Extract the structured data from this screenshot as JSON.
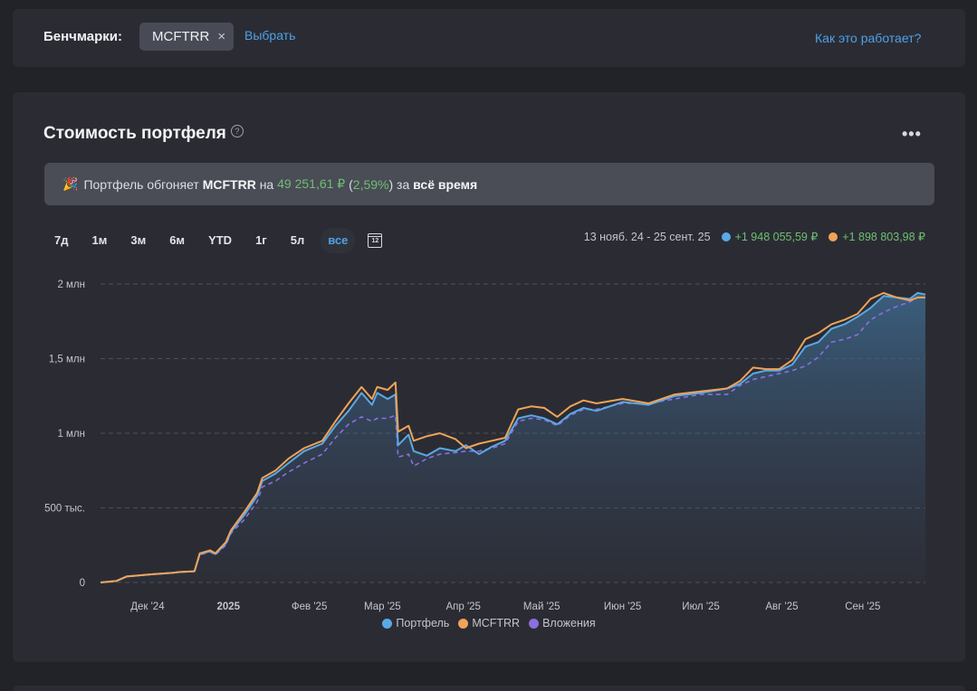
{
  "benchmarks": {
    "label": "Бенчмарки:",
    "chip": "MCFTRR",
    "chip_remove": "×",
    "choose_link": "Выбрать",
    "help_link": "Как это работает?"
  },
  "portfolio": {
    "title": "Стоимость портфеля",
    "help_icon": "?",
    "menu_icon": "•••",
    "banner": {
      "prefix": "Портфель обгоняет",
      "benchmark": "MCFTRR",
      "on": "на",
      "amount": "49 251,61 ₽",
      "paren_open": "(",
      "percent": "2,59%",
      "paren_close": ")",
      "for": "за",
      "period": "всё время"
    },
    "periods": [
      "7д",
      "1м",
      "3м",
      "6м",
      "YTD",
      "1г",
      "5л",
      "все"
    ],
    "active_period": "все",
    "calendar_day": "12",
    "summary": {
      "range": "13 нояб. 24 - 25 сент. 25",
      "portfolio_gain": "+1 948 055,59 ₽",
      "benchmark_gain": "+1 898 803,98 ₽"
    }
  },
  "colors": {
    "portfolio": "#5aa9e6",
    "benchmark": "#f0a35a",
    "investments": "#8b6fe0",
    "positive": "#6fbf73",
    "accent": "#4ea1e8"
  },
  "chart_data": {
    "type": "line",
    "y_ticks": [
      "0",
      "500 тыс.",
      "1 млн",
      "1,5 млн",
      "2 млн"
    ],
    "y_tick_values": [
      0,
      500000,
      1000000,
      1500000,
      2000000
    ],
    "ylim": [
      0,
      2000000
    ],
    "x_ticks": [
      "Дек '24",
      "2025",
      "Фев '25",
      "Мар '25",
      "Апр '25",
      "Май '25",
      "Июн '25",
      "Июл '25",
      "Авг '25",
      "Сен '25"
    ],
    "x_tick_days": [
      18,
      49,
      80,
      108,
      139,
      169,
      200,
      230,
      261,
      292
    ],
    "x_range_days": [
      0,
      316
    ],
    "legend": "bottom",
    "grid": "horizontal dashed",
    "series": [
      {
        "name": "Портфель",
        "points": [
          [
            0,
            0
          ],
          [
            6,
            10000
          ],
          [
            10,
            40000
          ],
          [
            20,
            55000
          ],
          [
            28,
            65000
          ],
          [
            30,
            70000
          ],
          [
            36,
            75000
          ],
          [
            38,
            190000
          ],
          [
            42,
            210000
          ],
          [
            44,
            190000
          ],
          [
            48,
            260000
          ],
          [
            50,
            340000
          ],
          [
            55,
            450000
          ],
          [
            60,
            580000
          ],
          [
            62,
            680000
          ],
          [
            67,
            730000
          ],
          [
            72,
            800000
          ],
          [
            78,
            880000
          ],
          [
            85,
            930000
          ],
          [
            90,
            1050000
          ],
          [
            95,
            1150000
          ],
          [
            100,
            1270000
          ],
          [
            104,
            1190000
          ],
          [
            106,
            1270000
          ],
          [
            110,
            1230000
          ],
          [
            113,
            1260000
          ],
          [
            114,
            920000
          ],
          [
            118,
            990000
          ],
          [
            120,
            880000
          ],
          [
            125,
            850000
          ],
          [
            130,
            900000
          ],
          [
            136,
            880000
          ],
          [
            140,
            920000
          ],
          [
            145,
            860000
          ],
          [
            150,
            910000
          ],
          [
            155,
            950000
          ],
          [
            160,
            1100000
          ],
          [
            165,
            1120000
          ],
          [
            170,
            1100000
          ],
          [
            175,
            1060000
          ],
          [
            180,
            1130000
          ],
          [
            185,
            1170000
          ],
          [
            190,
            1150000
          ],
          [
            200,
            1210000
          ],
          [
            210,
            1190000
          ],
          [
            220,
            1250000
          ],
          [
            230,
            1270000
          ],
          [
            240,
            1300000
          ],
          [
            245,
            1330000
          ],
          [
            250,
            1400000
          ],
          [
            255,
            1420000
          ],
          [
            260,
            1420000
          ],
          [
            265,
            1460000
          ],
          [
            270,
            1580000
          ],
          [
            275,
            1610000
          ],
          [
            280,
            1700000
          ],
          [
            285,
            1730000
          ],
          [
            290,
            1780000
          ],
          [
            295,
            1840000
          ],
          [
            300,
            1920000
          ],
          [
            305,
            1910000
          ],
          [
            310,
            1900000
          ],
          [
            313,
            1940000
          ],
          [
            316,
            1930000
          ]
        ]
      },
      {
        "name": "MCFTRR",
        "points": [
          [
            0,
            0
          ],
          [
            6,
            10000
          ],
          [
            10,
            40000
          ],
          [
            20,
            55000
          ],
          [
            28,
            65000
          ],
          [
            30,
            70000
          ],
          [
            36,
            75000
          ],
          [
            38,
            195000
          ],
          [
            42,
            215000
          ],
          [
            44,
            195000
          ],
          [
            48,
            270000
          ],
          [
            50,
            350000
          ],
          [
            55,
            470000
          ],
          [
            60,
            600000
          ],
          [
            62,
            700000
          ],
          [
            67,
            750000
          ],
          [
            72,
            830000
          ],
          [
            78,
            900000
          ],
          [
            85,
            950000
          ],
          [
            90,
            1080000
          ],
          [
            95,
            1200000
          ],
          [
            100,
            1310000
          ],
          [
            104,
            1230000
          ],
          [
            106,
            1310000
          ],
          [
            110,
            1290000
          ],
          [
            113,
            1340000
          ],
          [
            114,
            1010000
          ],
          [
            118,
            1050000
          ],
          [
            120,
            950000
          ],
          [
            125,
            980000
          ],
          [
            130,
            1000000
          ],
          [
            136,
            960000
          ],
          [
            140,
            900000
          ],
          [
            145,
            930000
          ],
          [
            150,
            950000
          ],
          [
            155,
            970000
          ],
          [
            160,
            1160000
          ],
          [
            165,
            1180000
          ],
          [
            170,
            1170000
          ],
          [
            175,
            1110000
          ],
          [
            180,
            1180000
          ],
          [
            185,
            1220000
          ],
          [
            190,
            1200000
          ],
          [
            200,
            1230000
          ],
          [
            210,
            1200000
          ],
          [
            220,
            1260000
          ],
          [
            230,
            1280000
          ],
          [
            240,
            1300000
          ],
          [
            245,
            1350000
          ],
          [
            250,
            1440000
          ],
          [
            255,
            1430000
          ],
          [
            260,
            1430000
          ],
          [
            265,
            1490000
          ],
          [
            270,
            1630000
          ],
          [
            275,
            1670000
          ],
          [
            280,
            1730000
          ],
          [
            285,
            1760000
          ],
          [
            290,
            1800000
          ],
          [
            295,
            1900000
          ],
          [
            300,
            1940000
          ],
          [
            305,
            1910000
          ],
          [
            310,
            1890000
          ],
          [
            313,
            1910000
          ],
          [
            316,
            1910000
          ]
        ]
      },
      {
        "name": "Вложения",
        "points": [
          [
            0,
            0
          ],
          [
            6,
            10000
          ],
          [
            10,
            40000
          ],
          [
            20,
            55000
          ],
          [
            28,
            65000
          ],
          [
            30,
            70000
          ],
          [
            36,
            75000
          ],
          [
            38,
            185000
          ],
          [
            42,
            205000
          ],
          [
            44,
            185000
          ],
          [
            48,
            250000
          ],
          [
            50,
            330000
          ],
          [
            55,
            420000
          ],
          [
            60,
            540000
          ],
          [
            62,
            640000
          ],
          [
            67,
            680000
          ],
          [
            72,
            740000
          ],
          [
            78,
            800000
          ],
          [
            85,
            860000
          ],
          [
            90,
            970000
          ],
          [
            95,
            1060000
          ],
          [
            100,
            1110000
          ],
          [
            104,
            1080000
          ],
          [
            106,
            1100000
          ],
          [
            110,
            1100000
          ],
          [
            113,
            1120000
          ],
          [
            114,
            840000
          ],
          [
            118,
            860000
          ],
          [
            120,
            780000
          ],
          [
            125,
            830000
          ],
          [
            130,
            860000
          ],
          [
            136,
            870000
          ],
          [
            140,
            880000
          ],
          [
            145,
            880000
          ],
          [
            150,
            900000
          ],
          [
            155,
            930000
          ],
          [
            160,
            1080000
          ],
          [
            165,
            1100000
          ],
          [
            170,
            1090000
          ],
          [
            175,
            1050000
          ],
          [
            180,
            1120000
          ],
          [
            185,
            1160000
          ],
          [
            190,
            1160000
          ],
          [
            200,
            1200000
          ],
          [
            210,
            1200000
          ],
          [
            220,
            1230000
          ],
          [
            230,
            1260000
          ],
          [
            240,
            1260000
          ],
          [
            245,
            1320000
          ],
          [
            250,
            1360000
          ],
          [
            255,
            1380000
          ],
          [
            260,
            1400000
          ],
          [
            265,
            1420000
          ],
          [
            270,
            1450000
          ],
          [
            275,
            1510000
          ],
          [
            280,
            1610000
          ],
          [
            285,
            1630000
          ],
          [
            290,
            1660000
          ],
          [
            295,
            1760000
          ],
          [
            300,
            1810000
          ],
          [
            305,
            1850000
          ],
          [
            310,
            1880000
          ],
          [
            313,
            1910000
          ],
          [
            316,
            1910000
          ]
        ]
      }
    ]
  }
}
